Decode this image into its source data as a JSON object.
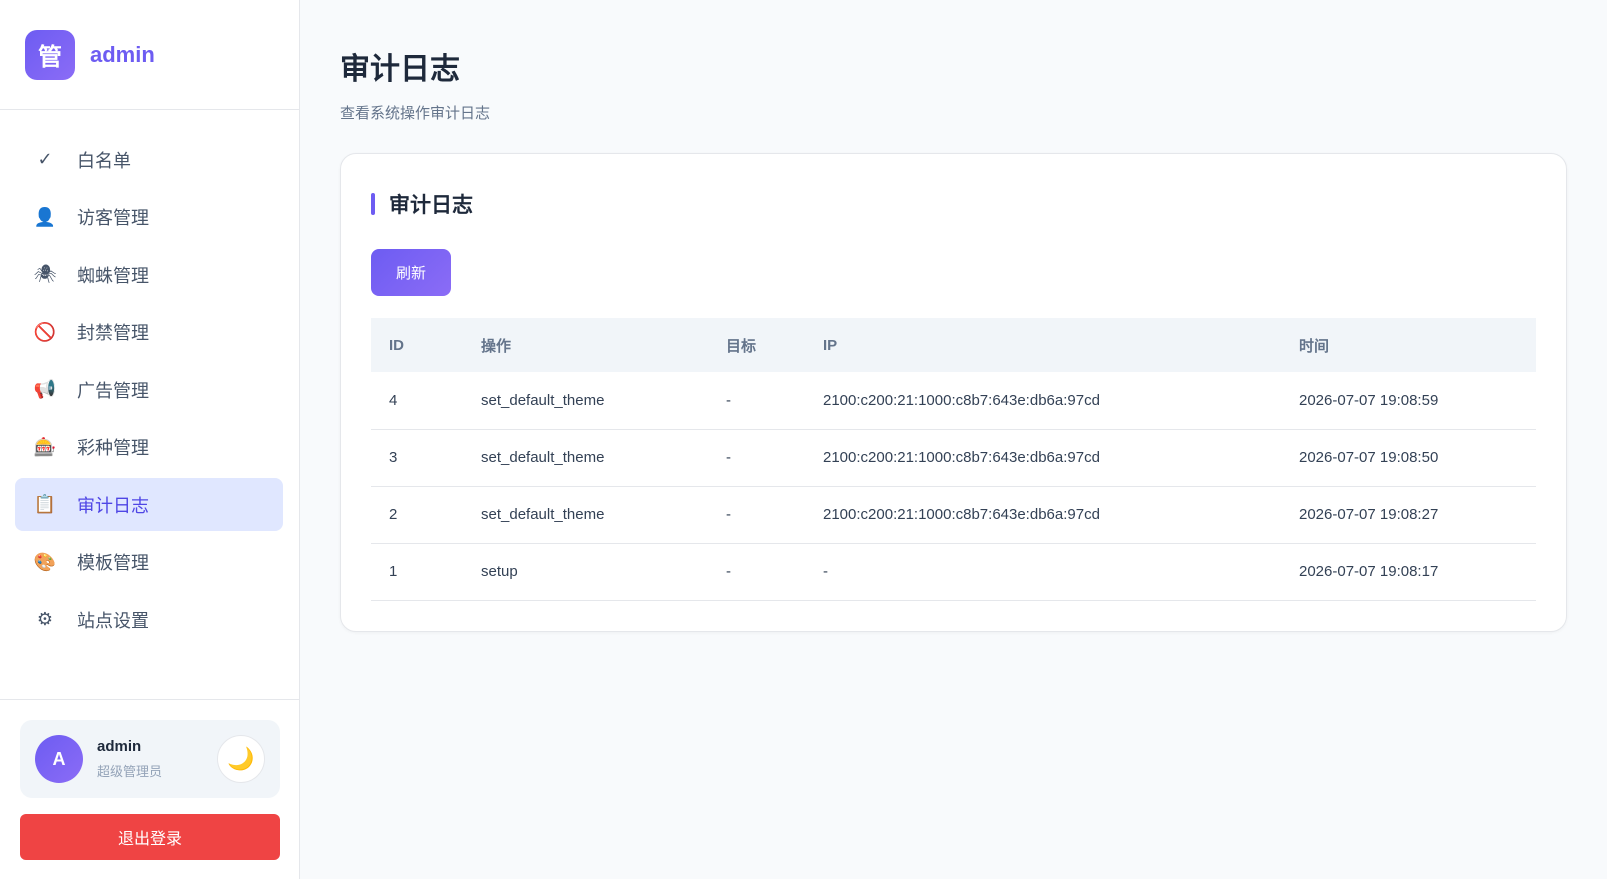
{
  "brand": {
    "logo_char": "管",
    "name": "admin"
  },
  "sidebar": {
    "items": [
      {
        "icon": "check-icon",
        "glyph": "✓",
        "label": "白名单",
        "active": false
      },
      {
        "icon": "visitor-icon",
        "glyph": "👤",
        "label": "访客管理",
        "active": false
      },
      {
        "icon": "spider-icon",
        "glyph": "🕷",
        "label": "蜘蛛管理",
        "active": false
      },
      {
        "icon": "ban-icon",
        "glyph": "🚫",
        "label": "封禁管理",
        "active": false
      },
      {
        "icon": "megaphone-icon",
        "glyph": "📢",
        "label": "广告管理",
        "active": false
      },
      {
        "icon": "lottery-icon",
        "glyph": "🎰",
        "label": "彩种管理",
        "active": false
      },
      {
        "icon": "clipboard-icon",
        "glyph": "📋",
        "label": "审计日志",
        "active": true
      },
      {
        "icon": "palette-icon",
        "glyph": "🎨",
        "label": "模板管理",
        "active": false
      },
      {
        "icon": "gear-icon",
        "glyph": "⚙",
        "label": "站点设置",
        "active": false
      }
    ]
  },
  "user": {
    "avatar_letter": "A",
    "name": "admin",
    "role": "超级管理员",
    "theme_glyph": "🌙"
  },
  "logout_label": "退出登录",
  "page": {
    "title": "审计日志",
    "subtitle": "查看系统操作审计日志"
  },
  "card": {
    "title": "审计日志",
    "refresh_label": "刷新"
  },
  "table": {
    "headers": [
      "ID",
      "操作",
      "目标",
      "IP",
      "时间"
    ],
    "rows": [
      [
        "4",
        "set_default_theme",
        "-",
        "2100:c200:21:1000:c8b7:643e:db6a:97cd",
        "2026-07-07 19:08:59"
      ],
      [
        "3",
        "set_default_theme",
        "-",
        "2100:c200:21:1000:c8b7:643e:db6a:97cd",
        "2026-07-07 19:08:50"
      ],
      [
        "2",
        "set_default_theme",
        "-",
        "2100:c200:21:1000:c8b7:643e:db6a:97cd",
        "2026-07-07 19:08:27"
      ],
      [
        "1",
        "setup",
        "-",
        "-",
        "2026-07-07 19:08:17"
      ]
    ]
  },
  "colors": {
    "accent": "#6d5cf2",
    "active_bg": "#e0e7ff",
    "danger": "#ef4444"
  }
}
